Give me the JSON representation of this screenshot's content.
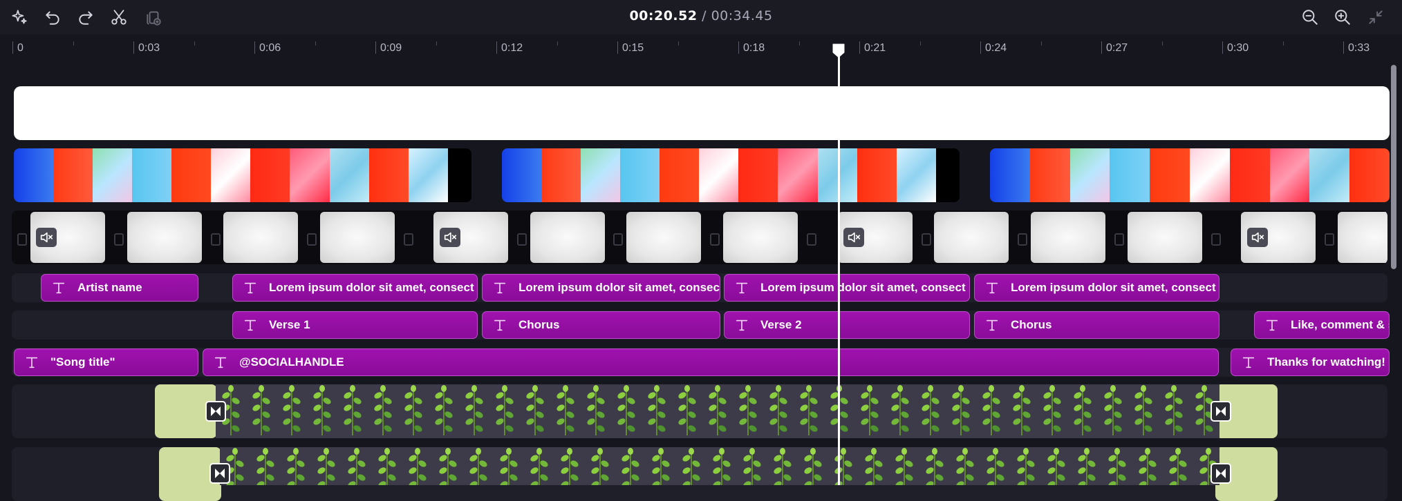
{
  "toolbar": {
    "left_icons": [
      "magic-wand-icon",
      "undo-icon",
      "redo-icon",
      "scissors-icon",
      "duplicate-icon"
    ],
    "right_icons": [
      "zoom-out-icon",
      "zoom-in-icon",
      "fit-to-screen-icon"
    ],
    "current_time": "00:20.52",
    "separator": " / ",
    "total_time": "00:34.45"
  },
  "ruler": {
    "labels": [
      "0",
      "0:03",
      "0:06",
      "0:09",
      "0:12",
      "0:15",
      "0:18",
      "0:21",
      "0:24",
      "0:27",
      "0:30",
      "0:33"
    ]
  },
  "playhead": {
    "time": "00:20.52"
  },
  "tracks": {
    "text_row1": [
      "Artist name",
      "Lorem ipsum dolor sit amet, consect",
      "Lorem ipsum dolor sit amet, consec",
      "Lorem ipsum dolor sit amet, consect",
      "Lorem ipsum dolor sit amet, consect"
    ],
    "text_row2": [
      "Verse 1",
      "Chorus",
      "Verse 2",
      "Chorus",
      "Like, comment & s"
    ],
    "text_row3": [
      "\"Song title\"",
      "@SOCIALHANDLE",
      "Thanks for watching!"
    ]
  },
  "colors": {
    "text_clip": "#9f12ae",
    "background": "#16161f",
    "green_end": "#cfdd9f"
  }
}
